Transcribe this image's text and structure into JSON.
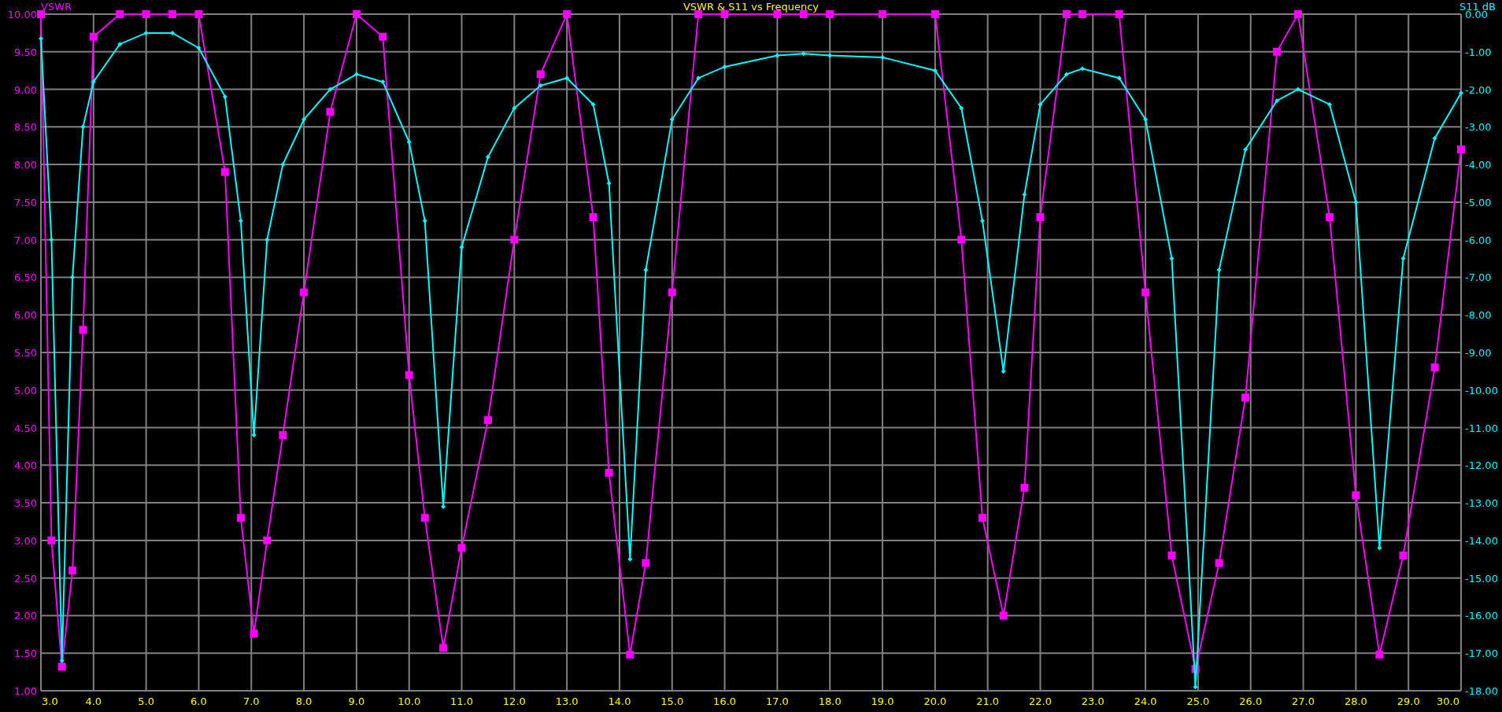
{
  "chart_data": {
    "type": "line",
    "title": "VSWR & S11 vs Frequency",
    "grid": true,
    "x": [
      3.0,
      3.2,
      3.4,
      3.6,
      3.8,
      4.0,
      4.5,
      5.0,
      5.5,
      6.0,
      6.5,
      6.8,
      7.05,
      7.3,
      7.6,
      8.0,
      8.5,
      9.0,
      9.5,
      10.0,
      10.3,
      10.65,
      11.0,
      11.5,
      12.0,
      12.5,
      13.0,
      13.5,
      13.8,
      14.2,
      14.5,
      15.0,
      15.5,
      16.0,
      17.0,
      17.5,
      18.0,
      19.0,
      20.0,
      20.5,
      20.9,
      21.3,
      21.7,
      22.0,
      22.5,
      22.8,
      23.5,
      24.0,
      24.5,
      24.95,
      25.4,
      25.9,
      26.5,
      26.9,
      27.5,
      28.0,
      28.45,
      28.9,
      29.5,
      30.0
    ],
    "series": [
      {
        "name": "VSWR",
        "color": "#ff00ff",
        "marker": "square",
        "values": [
          10,
          3.0,
          1.32,
          2.6,
          5.8,
          9.7,
          10,
          10,
          10,
          10,
          7.9,
          3.3,
          1.76,
          3.0,
          4.4,
          6.3,
          8.7,
          10,
          9.7,
          5.2,
          3.3,
          1.57,
          2.9,
          4.6,
          7.0,
          9.2,
          10,
          7.3,
          3.9,
          1.48,
          2.7,
          6.3,
          10,
          10,
          10,
          10,
          10,
          10,
          10,
          7.0,
          3.3,
          2.0,
          3.7,
          7.3,
          10,
          10,
          10,
          6.3,
          2.8,
          1.29,
          2.7,
          4.9,
          9.5,
          10,
          7.3,
          3.6,
          1.48,
          2.8,
          5.3,
          8.2
        ]
      },
      {
        "name": "S11 dB",
        "color": "#00ffff",
        "axis": "y2",
        "marker": "diamond",
        "values": [
          -0.65,
          -6.0,
          -17.2,
          -7.0,
          -3.0,
          -1.8,
          -0.8,
          -0.5,
          -0.5,
          -0.9,
          -2.2,
          -5.5,
          -11.2,
          -6.0,
          -4.0,
          -2.8,
          -2.0,
          -1.6,
          -1.8,
          -3.4,
          -5.5,
          -13.1,
          -6.2,
          -3.8,
          -2.5,
          -1.9,
          -1.7,
          -2.4,
          -4.5,
          -14.5,
          -6.8,
          -2.8,
          -1.7,
          -1.4,
          -1.1,
          -1.05,
          -1.1,
          -1.15,
          -1.5,
          -2.5,
          -5.5,
          -9.5,
          -4.8,
          -2.4,
          -1.6,
          -1.45,
          -1.7,
          -2.8,
          -6.5,
          -17.9,
          -6.8,
          -3.6,
          -2.3,
          -2.0,
          -2.4,
          -5.0,
          -14.2,
          -6.5,
          -3.3,
          -2.1
        ]
      }
    ],
    "xlim": [
      3,
      30
    ],
    "ylim": [
      1,
      10
    ],
    "y2lim": [
      -18,
      0
    ],
    "xticks": [
      {
        "value": 3,
        "label": "3.0"
      },
      {
        "value": 4,
        "label": "4.0"
      },
      {
        "value": 5,
        "label": "5.0"
      },
      {
        "value": 6,
        "label": "6.0"
      },
      {
        "value": 7,
        "label": "7.0"
      },
      {
        "value": 8,
        "label": "8.0"
      },
      {
        "value": 9,
        "label": "9.0"
      },
      {
        "value": 10,
        "label": "10.0"
      },
      {
        "value": 11,
        "label": "11.0"
      },
      {
        "value": 12,
        "label": "12.0"
      },
      {
        "value": 13,
        "label": "13.0"
      },
      {
        "value": 14,
        "label": "14.0"
      },
      {
        "value": 15,
        "label": "15.0"
      },
      {
        "value": 16,
        "label": "16.0"
      },
      {
        "value": 17,
        "label": "17.0"
      },
      {
        "value": 18,
        "label": "18.0"
      },
      {
        "value": 19,
        "label": "19.0"
      },
      {
        "value": 20,
        "label": "20.0"
      },
      {
        "value": 21,
        "label": "21.0"
      },
      {
        "value": 22,
        "label": "22.0"
      },
      {
        "value": 23,
        "label": "23.0"
      },
      {
        "value": 24,
        "label": "24.0"
      },
      {
        "value": 25,
        "label": "25.0"
      },
      {
        "value": 26,
        "label": "26.0"
      },
      {
        "value": 27,
        "label": "27.0"
      },
      {
        "value": 28,
        "label": "28.0"
      },
      {
        "value": 29,
        "label": "29.0"
      },
      {
        "value": 30,
        "label": "30.0"
      }
    ],
    "yticks": [
      {
        "value": 10,
        "label": "10.00"
      },
      {
        "value": 9.5,
        "label": "9.50"
      },
      {
        "value": 9,
        "label": "9.00"
      },
      {
        "value": 8.5,
        "label": "8.50"
      },
      {
        "value": 8,
        "label": "8.00"
      },
      {
        "value": 7.5,
        "label": "7.50"
      },
      {
        "value": 7,
        "label": "7.00"
      },
      {
        "value": 6.5,
        "label": "6.50"
      },
      {
        "value": 6,
        "label": "6.00"
      },
      {
        "value": 5.5,
        "label": "5.50"
      },
      {
        "value": 5,
        "label": "5.00"
      },
      {
        "value": 4.5,
        "label": "4.50"
      },
      {
        "value": 4,
        "label": "4.00"
      },
      {
        "value": 3.5,
        "label": "3.50"
      },
      {
        "value": 3,
        "label": "3.00"
      },
      {
        "value": 2.5,
        "label": "2.50"
      },
      {
        "value": 2,
        "label": "2.00"
      },
      {
        "value": 1.5,
        "label": "1.50"
      },
      {
        "value": 1,
        "label": "1.00"
      }
    ],
    "y2ticks": [
      {
        "value": 0,
        "label": "0.00"
      },
      {
        "value": -1,
        "label": "-1.00"
      },
      {
        "value": -2,
        "label": "-2.00"
      },
      {
        "value": -3,
        "label": "-3.00"
      },
      {
        "value": -4,
        "label": "-4.00"
      },
      {
        "value": -5,
        "label": "-5.00"
      },
      {
        "value": -6,
        "label": "-6.00"
      },
      {
        "value": -7,
        "label": "-7.00"
      },
      {
        "value": -8,
        "label": "-8.00"
      },
      {
        "value": -9,
        "label": "-9.00"
      },
      {
        "value": -10,
        "label": "-10.00"
      },
      {
        "value": -11,
        "label": "-11.00"
      },
      {
        "value": -12,
        "label": "-12.00"
      },
      {
        "value": -13,
        "label": "-13.00"
      },
      {
        "value": -14,
        "label": "-14.00"
      },
      {
        "value": -15,
        "label": "-15.00"
      },
      {
        "value": -16,
        "label": "-16.00"
      },
      {
        "value": -17,
        "label": "-17.00"
      },
      {
        "value": -18,
        "label": "-18.00"
      }
    ]
  }
}
